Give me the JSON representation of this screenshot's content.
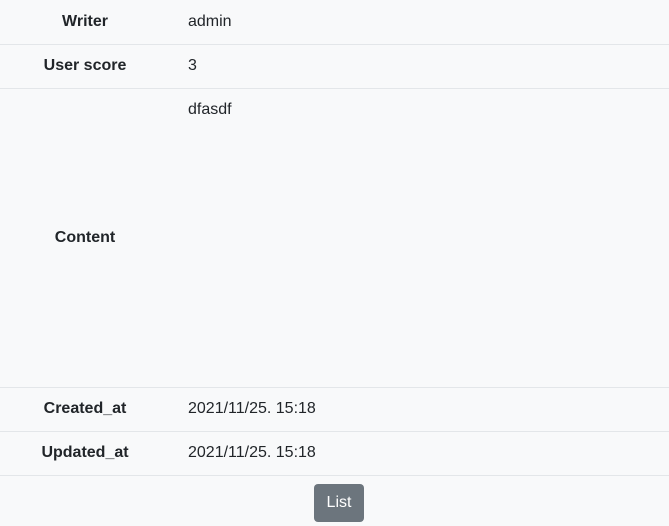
{
  "fields": {
    "writer": {
      "label": "Writer",
      "value": "admin"
    },
    "user_score": {
      "label": "User score",
      "value": "3"
    },
    "content": {
      "label": "Content",
      "value": "dfasdf"
    },
    "created_at": {
      "label": "Created_at",
      "value": "2021/11/25. 15:18"
    },
    "updated_at": {
      "label": "Updated_at",
      "value": "2021/11/25. 15:18"
    }
  },
  "actions": {
    "list_label": "List"
  }
}
